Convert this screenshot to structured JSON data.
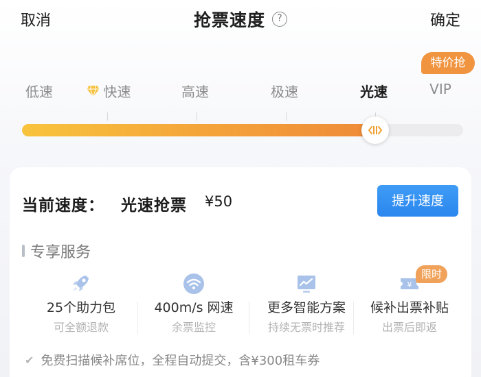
{
  "header": {
    "cancel_label": "取消",
    "title": "抢票速度",
    "help_icon": "?",
    "confirm_label": "确定"
  },
  "speed_tiers": [
    {
      "label": "低速",
      "active": false
    },
    {
      "label": "快速",
      "active": false,
      "icon": "diamond-icon"
    },
    {
      "label": "高速",
      "active": false
    },
    {
      "label": "极速",
      "active": false
    },
    {
      "label": "光速",
      "active": true
    },
    {
      "label": "VIP",
      "active": false
    }
  ],
  "promo_badge": "特价抢",
  "slider": {
    "level_fraction": 0.8,
    "selected_tier": "光速"
  },
  "current": {
    "label": "当前速度：",
    "value": "光速抢票",
    "price": "¥50",
    "upgrade_label": "提升速度"
  },
  "services_section": {
    "title": "专享服务",
    "items": [
      {
        "icon": "rocket-icon",
        "main": "25个助力包",
        "sub": "可全额退款"
      },
      {
        "icon": "wifi-icon",
        "main": "400m/s 网速",
        "sub": "余票监控"
      },
      {
        "icon": "chart-icon",
        "main": "更多智能方案",
        "sub": "持续无票时推荐"
      },
      {
        "icon": "ticket-icon",
        "main": "候补出票补贴",
        "sub": "出票后即返"
      }
    ],
    "limited_badge": "限时"
  },
  "footer_note": "免费扫描候补席位，全程自动提交，含¥300租车券",
  "colors": {
    "accent_orange": "#f09440",
    "slider_start": "#f8c33c",
    "slider_end": "#ee8a38",
    "button_blue": "#2b86ee"
  }
}
